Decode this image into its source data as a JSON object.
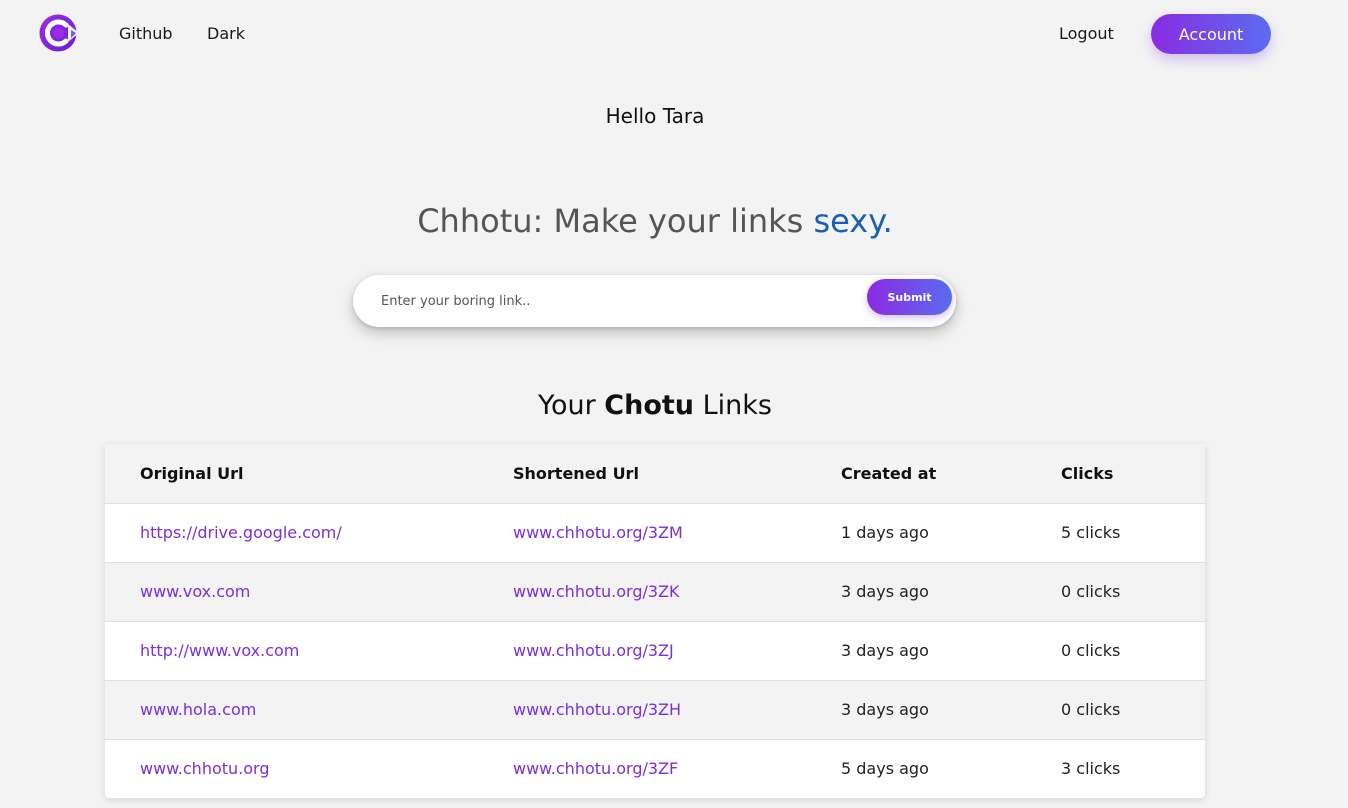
{
  "header": {
    "nav_github": "Github",
    "nav_dark": "Dark",
    "nav_logout": "Logout",
    "account_label": "Account"
  },
  "greeting": "Hello Tara",
  "hero": {
    "title_prefix": "Chhotu: Make your links ",
    "title_accent": "sexy."
  },
  "shortener": {
    "placeholder": "Enter your boring link..",
    "value": "",
    "submit_label": "Submit"
  },
  "links_section": {
    "title_before": "Your ",
    "title_bold": "Chotu",
    "title_after": " Links"
  },
  "table": {
    "headers": [
      "Original Url",
      "Shortened Url",
      "Created at",
      "Clicks"
    ],
    "rows": [
      [
        "https://drive.google.com/",
        "www.chhotu.org/3ZM",
        "1 days ago",
        "5 clicks"
      ],
      [
        "www.vox.com",
        "www.chhotu.org/3ZK",
        "3 days ago",
        "0 clicks"
      ],
      [
        "http://www.vox.com",
        "www.chhotu.org/3ZJ",
        "3 days ago",
        "0 clicks"
      ],
      [
        "www.hola.com",
        "www.chhotu.org/3ZH",
        "3 days ago",
        "0 clicks"
      ],
      [
        "www.chhotu.org",
        "www.chhotu.org/3ZF",
        "5 days ago",
        "3 clicks"
      ]
    ]
  },
  "colors": {
    "accent_purple": "#8a2be2",
    "accent_blue": "#5b6cf0",
    "link_color": "#7a2fdc",
    "hero_accent": "#1a5fb4",
    "page_bg": "#f3f3f3"
  },
  "icons": {
    "logo": "chhotu-logo-icon"
  }
}
